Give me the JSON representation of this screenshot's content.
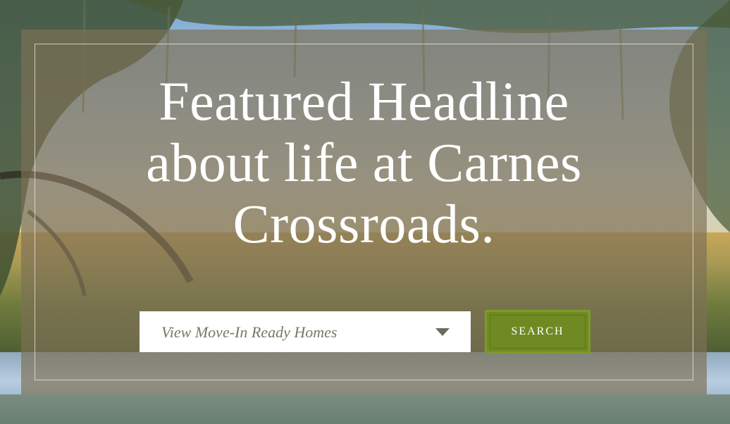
{
  "hero": {
    "headline_line1": "Featured Headline",
    "headline_line2": "about life at Carnes",
    "headline_line3": "Crossroads."
  },
  "search": {
    "select_value": "View Move-In Ready Homes",
    "button_label": "SEARCH"
  },
  "colors": {
    "overlay": "#7d7055",
    "button_bg": "#6f8a22",
    "select_bg": "#ffffff",
    "headline_text": "#ffffff"
  },
  "icons": {
    "dropdown": "chevron-down-icon"
  }
}
